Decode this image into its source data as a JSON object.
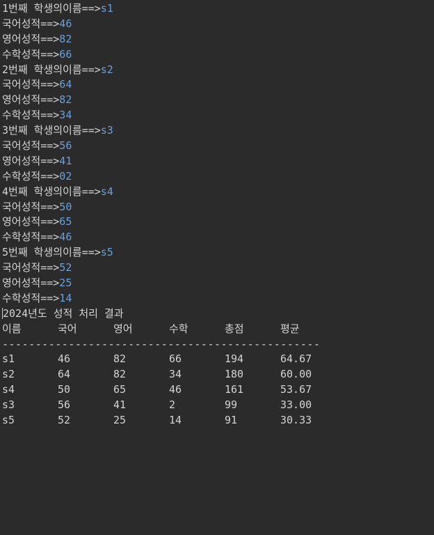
{
  "prompts": {
    "name_suffix": "번째 학생의이름==>",
    "kor": "국어성적==>",
    "eng": "영어성적==>",
    "math": "수학성적==>"
  },
  "students_input": [
    {
      "no": "1",
      "name": "s1",
      "kor": "46",
      "eng": "82",
      "math": "66"
    },
    {
      "no": "2",
      "name": "s2",
      "kor": "64",
      "eng": "82",
      "math": "34"
    },
    {
      "no": "3",
      "name": "s3",
      "kor": "56",
      "eng": "41",
      "math": "02"
    },
    {
      "no": "4",
      "name": "s4",
      "kor": "50",
      "eng": "65",
      "math": "46"
    },
    {
      "no": "5",
      "name": "s5",
      "kor": "52",
      "eng": "25",
      "math": "14"
    }
  ],
  "report": {
    "title": "2024년도 성적 처리 결과",
    "headers": [
      "이름",
      "국어",
      "영어",
      "수학",
      "총점",
      "평균"
    ],
    "divider": "------------------------------------------------",
    "rows": [
      [
        "s1",
        "46",
        "82",
        "66",
        "194",
        "64.67"
      ],
      [
        "s2",
        "64",
        "82",
        "34",
        "180",
        "60.00"
      ],
      [
        "s4",
        "50",
        "65",
        "46",
        "161",
        "53.67"
      ],
      [
        "s3",
        "56",
        "41",
        "2",
        "99",
        "33.00"
      ],
      [
        "s5",
        "52",
        "25",
        "14",
        "91",
        "30.33"
      ]
    ]
  },
  "colors": {
    "background": "#2b2b2b",
    "text": "#d4d4d4",
    "user_input": "#6ba0d8"
  }
}
